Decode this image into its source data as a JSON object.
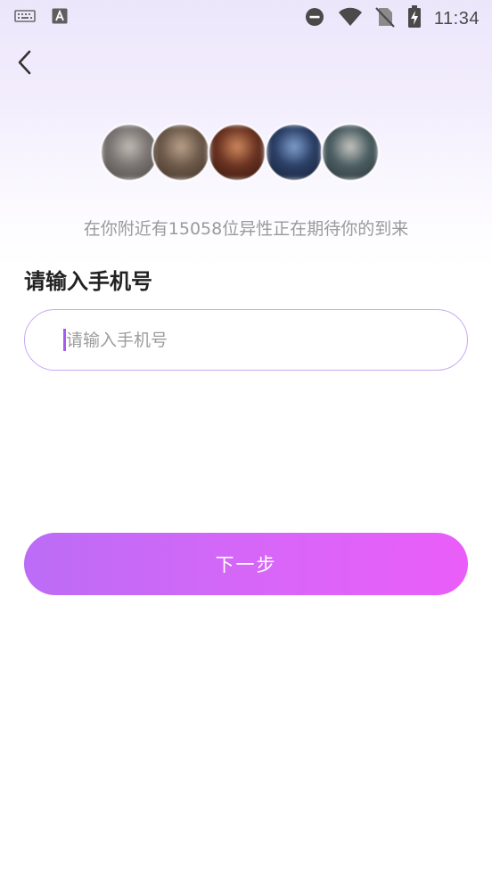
{
  "status_bar": {
    "time": "11:34",
    "left_icons": [
      "keyboard-icon",
      "a-app-icon"
    ],
    "right_icons": [
      "do-not-disturb-icon",
      "wifi-icon",
      "no-sim-icon",
      "battery-charging-icon"
    ]
  },
  "nav": {
    "back_icon": "chevron-left-icon"
  },
  "avatars": {
    "colors": [
      [
        "#7a7472",
        "#c2bcb6",
        "#4d4744"
      ],
      [
        "#6e5a4a",
        "#b9a28c",
        "#3f3128"
      ],
      [
        "#6b3322",
        "#d08a5e",
        "#2f140c"
      ],
      [
        "#2b3f66",
        "#7fa0cf",
        "#161f33"
      ],
      [
        "#4b5e62",
        "#c9c7c1",
        "#2b3336"
      ]
    ]
  },
  "nearby": {
    "text": "在你附近有15058位异性正在期待你的到来"
  },
  "form": {
    "title": "请输入手机号",
    "phone_placeholder": "请输入手机号",
    "phone_value": ""
  },
  "actions": {
    "next_label": "下一步"
  },
  "colors": {
    "accent": "#c8a7f2",
    "button_gradient_start": "#bb6cf6",
    "button_gradient_end": "#ea5df9",
    "caret": "#a45bf0"
  }
}
